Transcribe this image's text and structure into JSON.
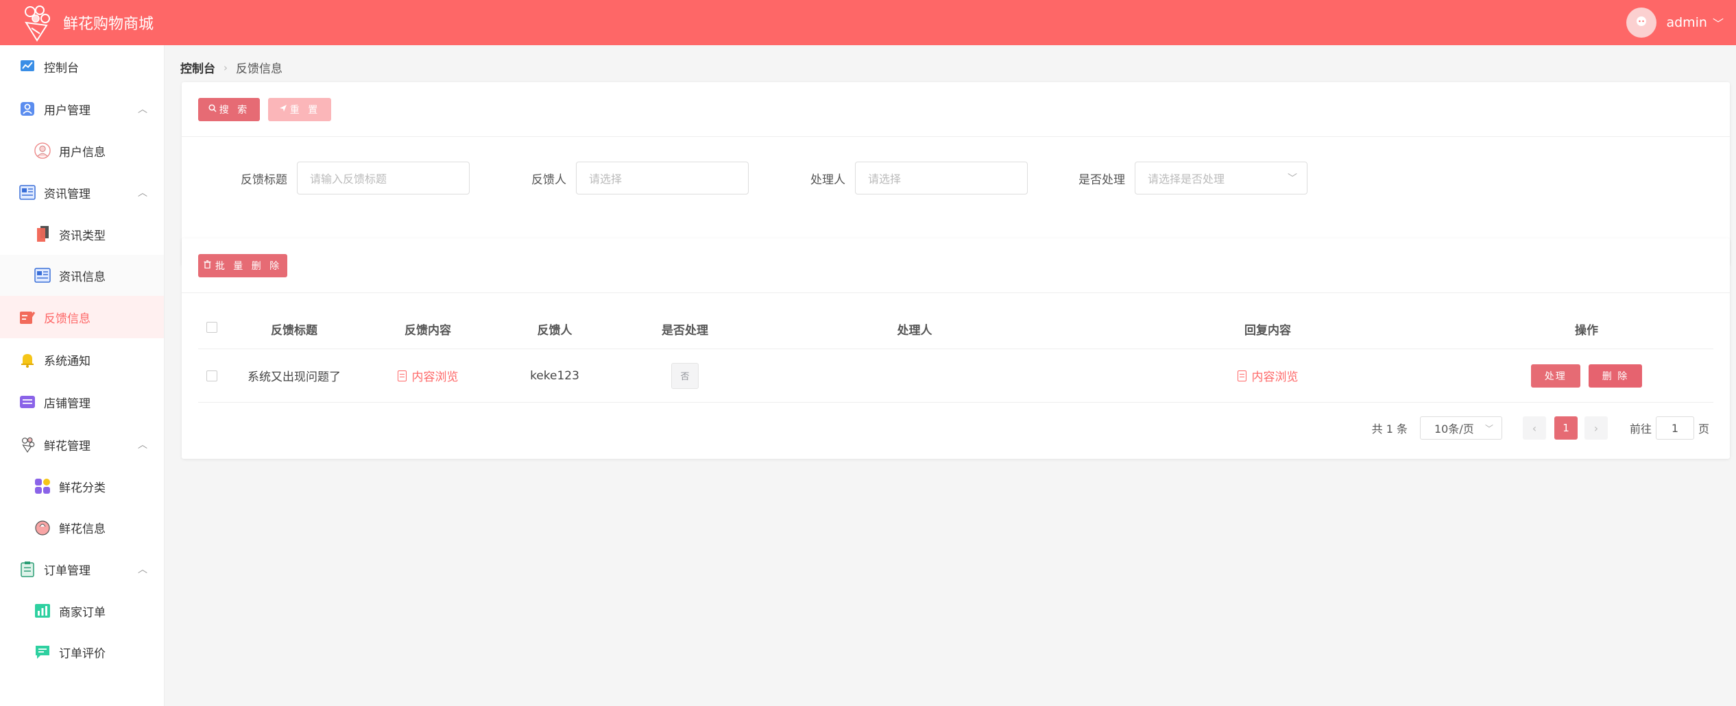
{
  "header": {
    "title": "鲜花购物商城",
    "username": "admin"
  },
  "sidebar": {
    "items": [
      {
        "label": "控制台"
      },
      {
        "label": "用户管理"
      },
      {
        "label": "用户信息"
      },
      {
        "label": "资讯管理"
      },
      {
        "label": "资讯类型"
      },
      {
        "label": "资讯信息"
      },
      {
        "label": "反馈信息"
      },
      {
        "label": "系统通知"
      },
      {
        "label": "店铺管理"
      },
      {
        "label": "鲜花管理"
      },
      {
        "label": "鲜花分类"
      },
      {
        "label": "鲜花信息"
      },
      {
        "label": "订单管理"
      },
      {
        "label": "商家订单"
      },
      {
        "label": "订单评价"
      }
    ]
  },
  "breadcrumb": {
    "root": "控制台",
    "current": "反馈信息"
  },
  "toolbar": {
    "search_label": "搜 索",
    "reset_label": "重 置",
    "batch_delete_label": "批 量 删 除"
  },
  "filters": [
    {
      "label": "反馈标题",
      "placeholder": "请输入反馈标题"
    },
    {
      "label": "反馈人",
      "placeholder": "请选择"
    },
    {
      "label": "处理人",
      "placeholder": "请选择"
    },
    {
      "label": "是否处理",
      "placeholder": "请选择是否处理"
    }
  ],
  "table": {
    "columns": [
      "反馈标题",
      "反馈内容",
      "反馈人",
      "是否处理",
      "处理人",
      "回复内容",
      "操作"
    ],
    "rows": [
      {
        "title": "系统又出现问题了",
        "content_link": "内容浏览",
        "user": "keke123",
        "handled": "否",
        "handler": "",
        "reply_link": "内容浏览",
        "handle_btn": "处理",
        "delete_btn": "删 除"
      }
    ]
  },
  "pagination": {
    "total": "共 1 条",
    "page_size": "10条/页",
    "current_page": "1",
    "goto_label": "前往",
    "goto_value": "1",
    "page_suffix": "页"
  },
  "colors": {
    "header": "#fe6767",
    "accent": "#e66b74",
    "active_bg": "#fff0f0"
  }
}
